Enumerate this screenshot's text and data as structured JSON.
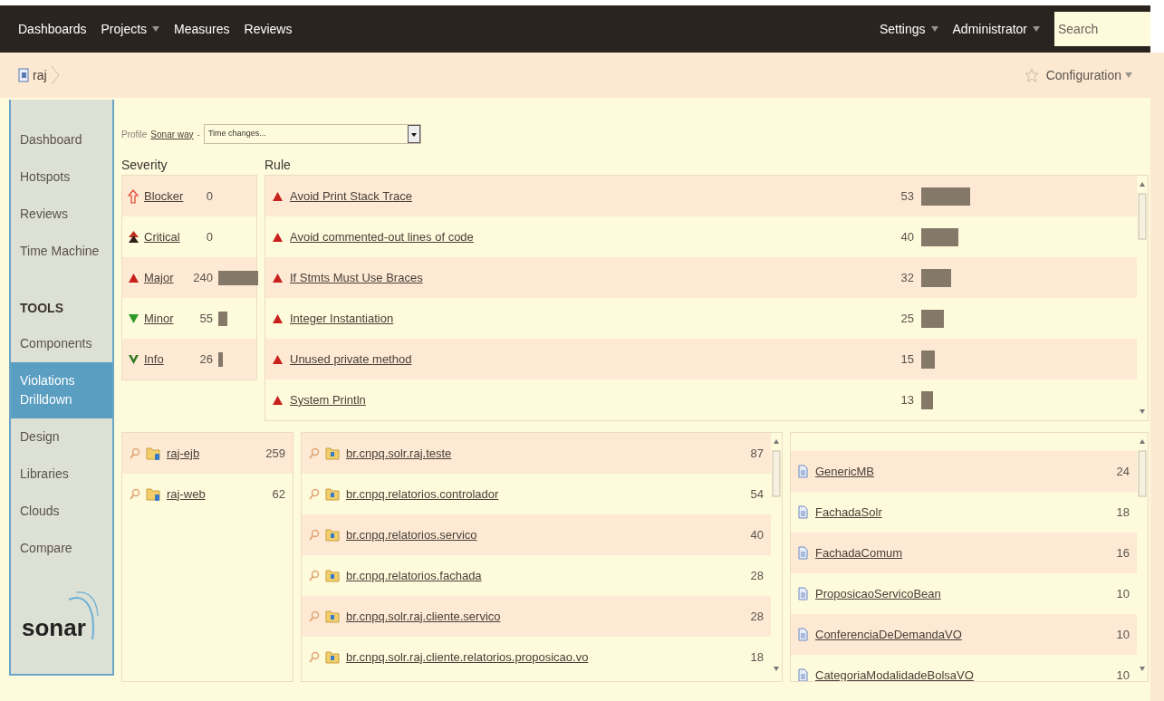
{
  "top_nav": {
    "items": [
      {
        "label": "Dashboards",
        "dropdown": false
      },
      {
        "label": "Projects",
        "dropdown": true
      },
      {
        "label": "Measures",
        "dropdown": false
      },
      {
        "label": "Reviews",
        "dropdown": false
      }
    ],
    "right_items": [
      {
        "label": "Settings",
        "dropdown": true
      },
      {
        "label": "Administrator",
        "dropdown": true
      }
    ],
    "search": {
      "placeholder": "Search"
    }
  },
  "breadcrumb": {
    "project": "raj",
    "configuration": "Configuration"
  },
  "sidebar": {
    "items": [
      {
        "label": "Dashboard",
        "selected": false
      },
      {
        "label": "Hotspots",
        "selected": false
      },
      {
        "label": "Reviews",
        "selected": false
      },
      {
        "label": "Time Machine",
        "selected": false
      }
    ],
    "section": "TOOLS",
    "tools": [
      {
        "label": "Components",
        "selected": false
      },
      {
        "label": "Violations Drilldown",
        "selected": true
      },
      {
        "label": "Design",
        "selected": false
      },
      {
        "label": "Libraries",
        "selected": false
      },
      {
        "label": "Clouds",
        "selected": false
      },
      {
        "label": "Compare",
        "selected": false
      }
    ],
    "logo": "sonar"
  },
  "filter": {
    "label": "Profile",
    "profile": "Sonar way",
    "separator": "-",
    "period": "Time changes..."
  },
  "severity": {
    "title": "Severity",
    "rows": [
      {
        "kind": "blocker",
        "name": "Blocker",
        "count": "0"
      },
      {
        "kind": "critical",
        "name": "Critical",
        "count": "0"
      },
      {
        "kind": "major",
        "name": "Major",
        "count": "240"
      },
      {
        "kind": "minor",
        "name": "Minor",
        "count": "55"
      },
      {
        "kind": "info",
        "name": "Info",
        "count": "26"
      }
    ]
  },
  "rules": {
    "title": "Rule",
    "rows": [
      {
        "name": "Avoid Print Stack Trace",
        "count": "53"
      },
      {
        "name": "Avoid commented-out lines of code",
        "count": "40"
      },
      {
        "name": "If Stmts Must Use Braces",
        "count": "32"
      },
      {
        "name": "Integer Instantiation",
        "count": "25"
      },
      {
        "name": "Unused private method",
        "count": "15"
      },
      {
        "name": "System Println",
        "count": "13"
      }
    ]
  },
  "modules": [
    {
      "name": "raj-ejb",
      "count": "259"
    },
    {
      "name": "raj-web",
      "count": "62"
    }
  ],
  "packages": [
    {
      "name": "br.cnpq.solr.raj.teste",
      "count": "87"
    },
    {
      "name": "br.cnpq.relatorios.controlador",
      "count": "54"
    },
    {
      "name": "br.cnpq.relatorios.servico",
      "count": "40"
    },
    {
      "name": "br.cnpq.relatorios.fachada",
      "count": "28"
    },
    {
      "name": "br.cnpq.solr.raj.cliente.servico",
      "count": "28"
    },
    {
      "name": "br.cnpq.solr.raj.cliente.relatorios.proposicao.vo",
      "count": "18"
    }
  ],
  "files": [
    {
      "name": "GenericMB",
      "count": "24"
    },
    {
      "name": "FachadaSolr",
      "count": "18"
    },
    {
      "name": "FachadaComum",
      "count": "16"
    },
    {
      "name": "ProposicaoServicoBean",
      "count": "10"
    },
    {
      "name": "ConferenciaDeDemandaVO",
      "count": "10"
    },
    {
      "name": "CategoriaModalidadeBolsaVO",
      "count": "10"
    }
  ]
}
